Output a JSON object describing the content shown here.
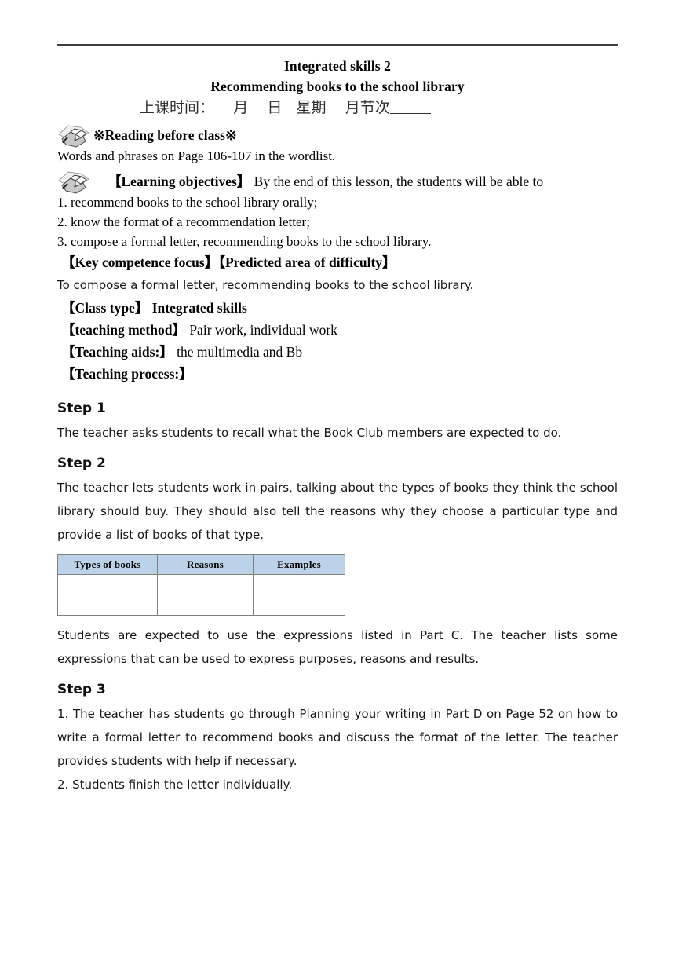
{
  "document": {
    "title_line_1": "Integrated skills 2",
    "title_line_2": "Recommending books to the school library",
    "class_time_label": "上课时间：",
    "class_time_month": "月",
    "class_time_day": "日",
    "class_time_weekday": "星期",
    "class_time_period": "月节次",
    "class_time_blank": "______"
  },
  "reading": {
    "heading": "※Reading before class※",
    "body": "Words and phrases on Page 106-107 in the wordlist.",
    "icon": "open-book-icon"
  },
  "objectives": {
    "heading_bracket": "【Learning objectives】",
    "heading_rest": " By the end of this lesson, the students will be able to",
    "icon": "open-book-icon",
    "items": [
      "1. recommend books to the school library orally;",
      "2. know the format of a recommendation letter;",
      "3. compose a formal letter, recommending books to the school library."
    ]
  },
  "key_competence": {
    "heading": "【Key competence focus】【Predicted area of difficulty】",
    "body": "To compose a formal letter, recommending books to the school library."
  },
  "class_type": {
    "label": "【Class type】",
    "value": "Integrated skills"
  },
  "teaching_method": {
    "label": "【teaching method】",
    "value": "Pair work, individual work"
  },
  "teaching_aids": {
    "label": "【Teaching aids:】",
    "value": "the multimedia and Bb"
  },
  "teaching_process": {
    "label": "【Teaching process:】"
  },
  "steps": [
    {
      "heading": "Step 1",
      "paragraphs": [
        "The teacher asks students to recall what the Book Club members are expected to do."
      ]
    },
    {
      "heading": "Step 2",
      "paragraphs": [
        "The teacher lets students work in pairs, talking about the types of books they think the school library should buy. They should also tell the reasons why they choose a particular type and provide a list of books of that type."
      ],
      "after_table_paragraphs": [
        "Students are expected to use the expressions listed in Part C. The teacher lists some expressions that can be used to express purposes, reasons and results."
      ]
    },
    {
      "heading": "Step 3",
      "paragraphs": [
        "1. The teacher has students go through Planning your writing in Part D on Page 52 on how to write a formal letter to recommend books and discuss the format of the letter. The teacher provides students with help if necessary.",
        "2. Students finish the letter individually."
      ]
    }
  ],
  "table": {
    "headers": [
      "Types of books",
      "Reasons",
      "Examples"
    ],
    "rows": [
      [
        "",
        "",
        ""
      ],
      [
        "",
        "",
        ""
      ]
    ],
    "header_bg": "#bcd2e8",
    "border_color": "#808080"
  }
}
